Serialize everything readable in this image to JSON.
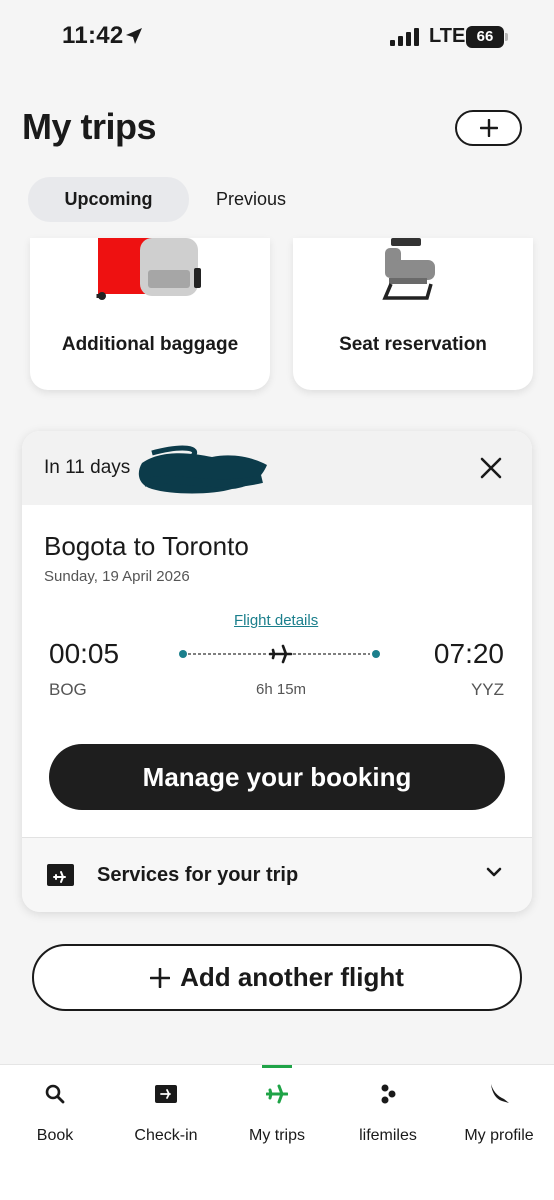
{
  "status_bar": {
    "time": "11:42",
    "network": "LTE",
    "battery": "66"
  },
  "header": {
    "title": "My trips"
  },
  "tabs": [
    {
      "label": "Upcoming",
      "active": true
    },
    {
      "label": "Previous",
      "active": false
    }
  ],
  "addons": [
    {
      "label": "Additional baggage",
      "icon": "baggage-icon"
    },
    {
      "label": "Seat reservation",
      "icon": "seat-icon"
    }
  ],
  "trip": {
    "countdown": "In 11 days",
    "route": "Bogota to Toronto",
    "date": "Sunday, 19 April 2026",
    "flight_details_link": "Flight details",
    "departure": {
      "time": "00:05",
      "code": "BOG"
    },
    "arrival": {
      "time": "07:20",
      "code": "YYZ"
    },
    "duration": "6h 15m",
    "manage_button": "Manage your booking",
    "services_label": "Services for your trip"
  },
  "add_flight_button": "Add another flight",
  "bottom_nav": [
    {
      "label": "Book",
      "icon": "search-icon"
    },
    {
      "label": "Check-in",
      "icon": "boarding-pass-icon"
    },
    {
      "label": "My trips",
      "icon": "airplane-icon",
      "active": true
    },
    {
      "label": "lifemiles",
      "icon": "lifemiles-icon"
    },
    {
      "label": "My profile",
      "icon": "bird-icon"
    }
  ],
  "colors": {
    "accent_green": "#1fa347",
    "link_teal": "#1b7f8c",
    "dark_button": "#1e1e1e",
    "background": "#f5f5f5"
  }
}
